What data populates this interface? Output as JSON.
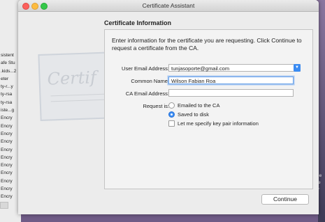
{
  "window": {
    "title": "Certificate Assistant"
  },
  "heading": "Certificate Information",
  "intro": "Enter information for the certificate you are requesting. Click Continue to request a certificate from the CA.",
  "form": {
    "user_email_label": "User Email Address:",
    "user_email_value": "tunjasoporte@gmail.com",
    "common_name_label": "Common Name:",
    "common_name_value": "Wilson Fabian Roa",
    "ca_email_label": "CA Email Address:",
    "ca_email_value": "",
    "request_is_label": "Request is:",
    "options": [
      {
        "label": "Emailed to the CA",
        "selected": false
      },
      {
        "label": "Saved to disk",
        "selected": true
      }
    ],
    "key_pair_label": "Let me specify key pair information",
    "key_pair_checked": false
  },
  "continue_label": "Continue",
  "illustration": {
    "word": "Certif"
  },
  "background_list": {
    "items": [
      "sistent",
      "afe Stu",
      ".kids...2",
      "eter",
      "ty-r...y",
      "ty-rsa",
      "ty-rsa",
      "iste...g",
      "Encry",
      "Encry",
      "Encry",
      "Encry",
      "Encry",
      "Encry",
      "Encry",
      "Encry",
      "Encry",
      "Encry",
      "Encry"
    ]
  },
  "right_edge_text": [
    "ie",
    "e",
    "r"
  ],
  "colors": {
    "accent": "#3a8bf2",
    "desktop": "#6f5b86"
  }
}
